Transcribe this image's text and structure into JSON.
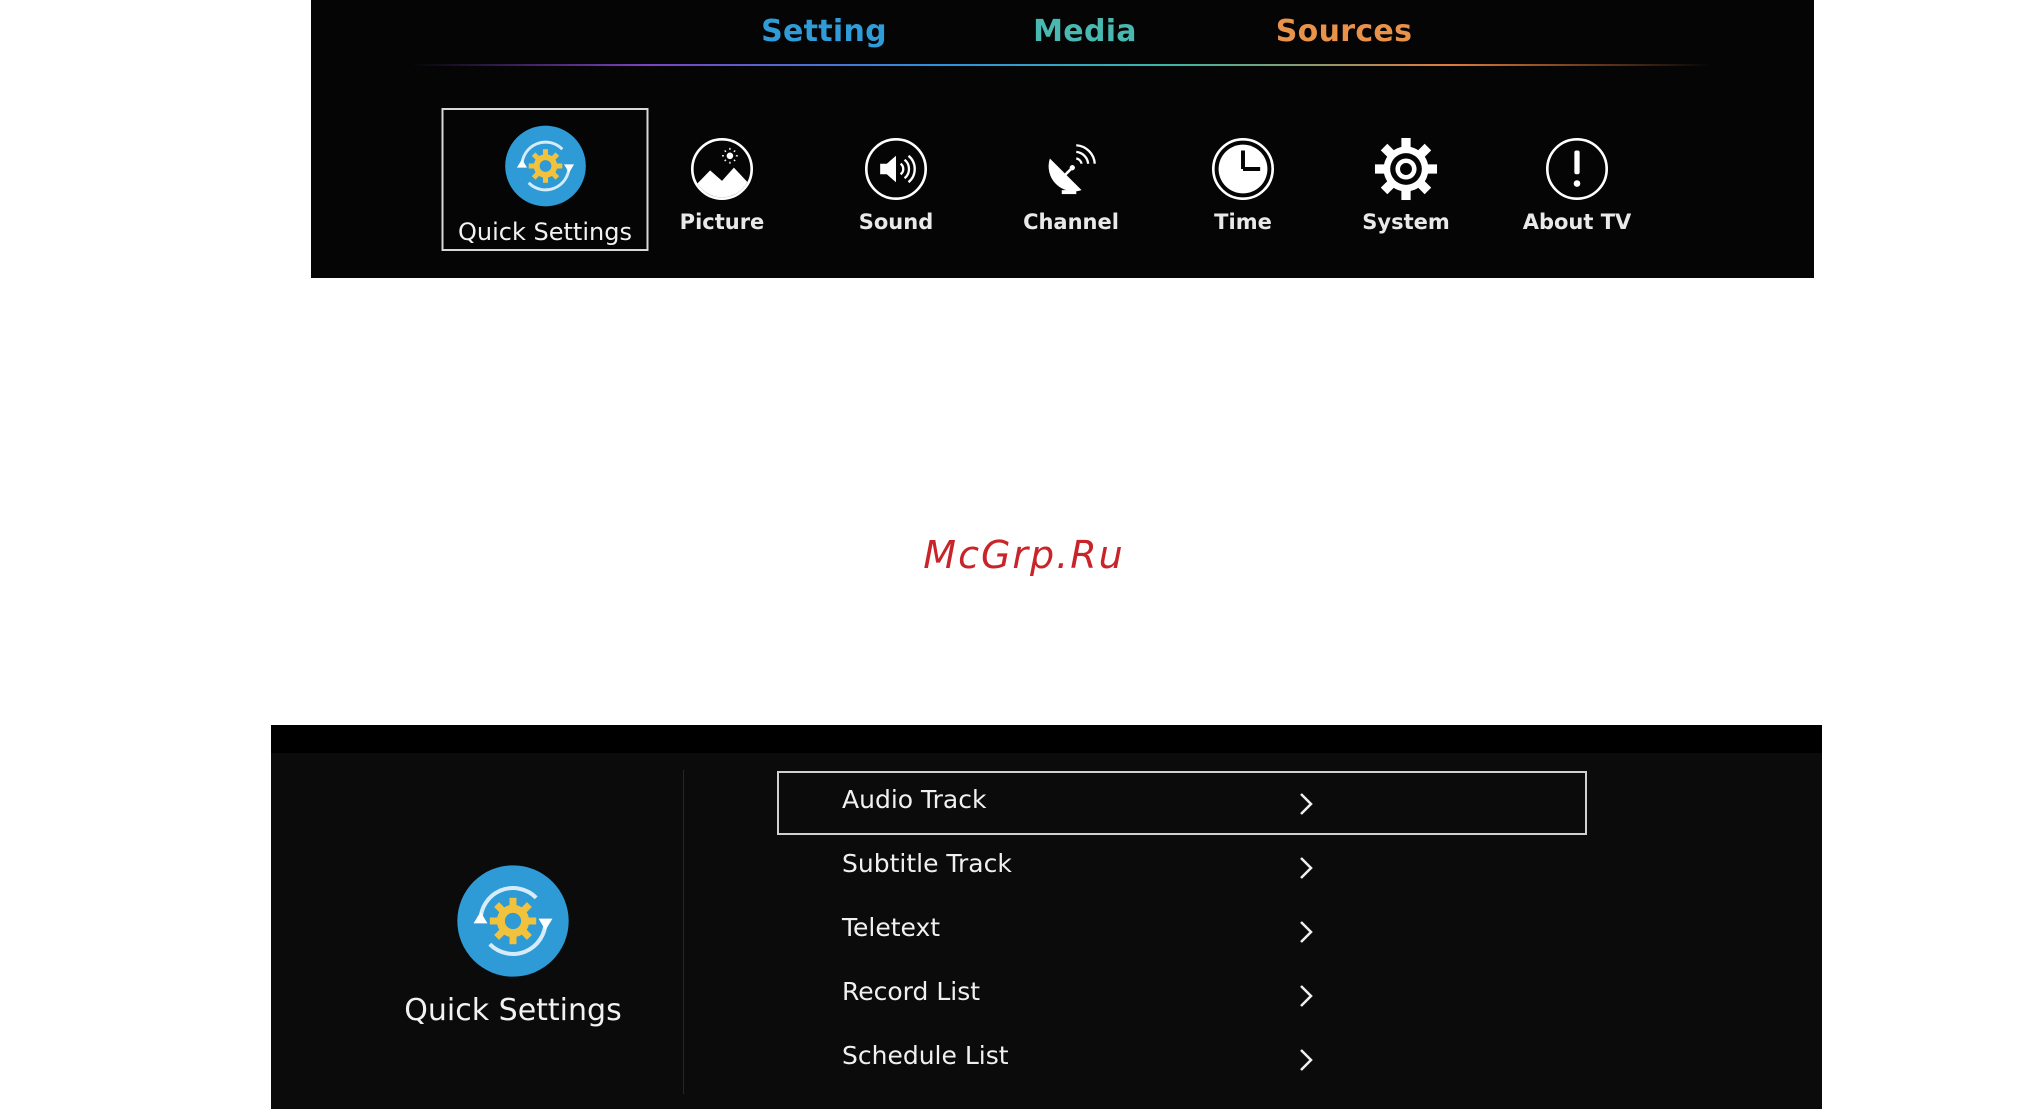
{
  "top_menu": {
    "tabs": [
      {
        "label": "Setting",
        "color": "#2f9bd8"
      },
      {
        "label": "Media",
        "color": "#49b8b0"
      },
      {
        "label": "Sources",
        "color": "#e8924a"
      }
    ],
    "items": [
      {
        "label": "Quick Settings",
        "icon": "quick-settings-icon",
        "selected": true
      },
      {
        "label": "Picture",
        "icon": "picture-icon"
      },
      {
        "label": "Sound",
        "icon": "sound-icon"
      },
      {
        "label": "Channel",
        "icon": "channel-icon"
      },
      {
        "label": "Time",
        "icon": "clock-icon"
      },
      {
        "label": "System",
        "icon": "gear-icon"
      },
      {
        "label": "About TV",
        "icon": "info-icon"
      }
    ]
  },
  "watermark": {
    "text": "McGrp.Ru",
    "color": "#c8242a"
  },
  "quick_settings": {
    "title": "Quick Settings",
    "icon": "quick-settings-icon",
    "items": [
      {
        "label": "Audio Track",
        "selected": true
      },
      {
        "label": "Subtitle Track"
      },
      {
        "label": "Teletext"
      },
      {
        "label": "Record List"
      },
      {
        "label": "Schedule List"
      }
    ]
  },
  "colors": {
    "panel_bg": "#050505",
    "accent_blue": "#2e9ad6",
    "text": "#f0f0f0"
  }
}
